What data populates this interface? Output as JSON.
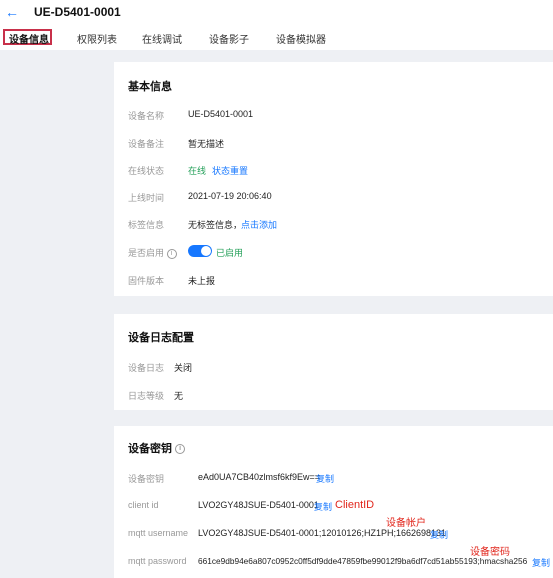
{
  "header": {
    "back_icon": "arrow-left-icon",
    "title": "UE-D5401-0001"
  },
  "tabs": [
    "设备信息",
    "权限列表",
    "在线调试",
    "设备影子",
    "设备模拟器"
  ],
  "basic_info": {
    "title": "基本信息",
    "rows": {
      "name": {
        "label": "设备名称",
        "value": "UE-D5401-0001"
      },
      "remark": {
        "label": "设备备注",
        "value": "暂无描述"
      },
      "online": {
        "label": "在线状态",
        "value": "在线",
        "action": "状态重置"
      },
      "report_time": {
        "label": "上线时间",
        "value": "2021-07-19 20:06:40"
      },
      "tags": {
        "label": "标签信息",
        "value": "无标签信息，",
        "action": "点击添加"
      },
      "enabled": {
        "label": "是否启用",
        "value": "已启用",
        "on": true
      },
      "firmware": {
        "label": "固件版本",
        "value": "未上报"
      }
    }
  },
  "log_config": {
    "title": "设备日志配置",
    "rows": {
      "log": {
        "label": "设备日志",
        "value": "关闭"
      },
      "level": {
        "label": "日志等级",
        "value": "无"
      }
    }
  },
  "credentials": {
    "title": "设备密钥",
    "copy_label": "复制",
    "rows": {
      "secret": {
        "label": "设备密钥",
        "value": "eAd0UA7CB40zlmsf6kf9Ew=="
      },
      "client_id": {
        "label": "client id",
        "value": "LVO2GY48JSUE-D5401-0001"
      },
      "username": {
        "label": "mqtt username",
        "value": "LVO2GY48JSUE-D5401-0001;12010126;HZ1PH;1662698131"
      },
      "password": {
        "label": "mqtt password",
        "value": "661ce9db94e6a807c0952c0ff5df9dde47859fbe99012f9ba6df7cd51ab55193;hmacsha256"
      }
    }
  },
  "annotations": {
    "client_id": "ClientID",
    "username": "设备帐户",
    "password": "设备密码"
  },
  "colors": {
    "accent": "#1677ff",
    "online": "#25a05a",
    "annotation": "#e1251b",
    "active_tab_border": "#c8304a"
  }
}
